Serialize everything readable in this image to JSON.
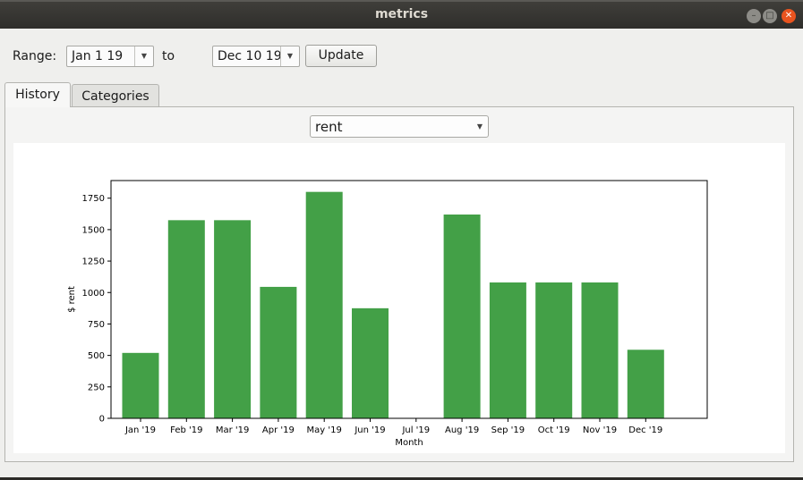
{
  "window": {
    "title": "metrics"
  },
  "toolbar": {
    "range_label": "Range:",
    "start_date": "Jan 1 19",
    "to_label": "to",
    "end_date": "Dec 10 19",
    "update_label": "Update"
  },
  "tabs": [
    {
      "label": "History",
      "active": true
    },
    {
      "label": "Categories",
      "active": false
    }
  ],
  "category_select": {
    "value": "rent"
  },
  "icons": {
    "dropdown": "chevron-down-icon",
    "minimize": "minimize-icon",
    "maximize": "maximize-icon",
    "close": "close-icon"
  },
  "colors": {
    "bar": "#43a047",
    "close_button": "#e9541f"
  },
  "chart_data": {
    "type": "bar",
    "categories": [
      "Jan '19",
      "Feb '19",
      "Mar '19",
      "Apr '19",
      "May '19",
      "Jun '19",
      "Jul '19",
      "Aug '19",
      "Sep '19",
      "Oct '19",
      "Nov '19",
      "Dec '19"
    ],
    "values": [
      520,
      1575,
      1575,
      1045,
      1800,
      875,
      0,
      1620,
      1080,
      1080,
      1080,
      545
    ],
    "xlabel": "Month",
    "ylabel": "$ rent",
    "ylim": [
      0,
      1890
    ],
    "yticks": [
      0,
      250,
      500,
      750,
      1000,
      1250,
      1500,
      1750
    ],
    "grid": false
  }
}
